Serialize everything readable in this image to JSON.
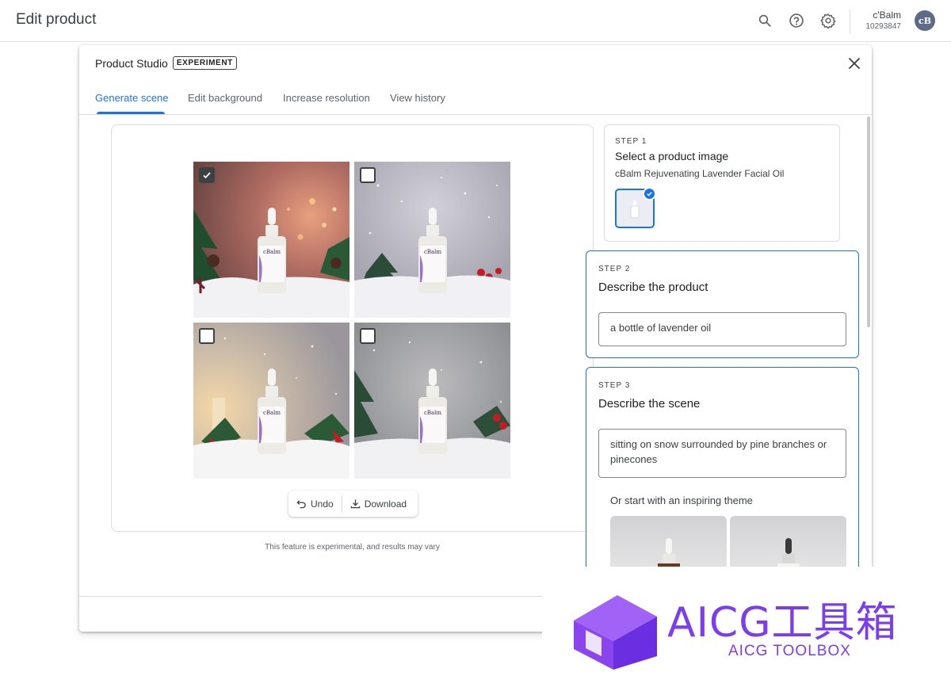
{
  "topbar": {
    "title": "Edit product",
    "account_name": "c'Balm",
    "account_id": "10293847",
    "avatar_initials": "cB"
  },
  "modal": {
    "title": "Product Studio",
    "badge": "EXPERIMENT",
    "tabs": [
      {
        "label": "Generate scene",
        "active": true
      },
      {
        "label": "Edit background",
        "active": false
      },
      {
        "label": "Increase resolution",
        "active": false
      },
      {
        "label": "View history",
        "active": false
      }
    ]
  },
  "preview": {
    "tiles": [
      {
        "selected": true,
        "scene": "warm bokeh with pine and pinecones"
      },
      {
        "selected": false,
        "scene": "snowfall with pine and red berries"
      },
      {
        "selected": false,
        "scene": "candle light with pine and ribbon"
      },
      {
        "selected": false,
        "scene": "grey snowfall with pine and berries"
      }
    ],
    "bottle_brand": "cBalm",
    "undo_label": "Undo",
    "download_label": "Download",
    "disclaimer": "This feature is experimental, and results may vary"
  },
  "step1": {
    "label": "STEP 1",
    "title": "Select a product image",
    "product_name": "cBalm Rejuvenating Lavender Facial Oil"
  },
  "step2": {
    "label": "STEP 2",
    "title": "Describe the product",
    "value": "a bottle of lavender oil"
  },
  "step3": {
    "label": "STEP 3",
    "title": "Describe the scene",
    "value": "sitting on snow surrounded by pine branches or pinecones",
    "theme_prompt": "Or start with an inspiring theme"
  },
  "watermark": {
    "text": "AICG工具箱",
    "subtext": "AICG TOOLBOX"
  },
  "colors": {
    "accent": "#1a73e8",
    "watermark": "#7a3ef0"
  }
}
